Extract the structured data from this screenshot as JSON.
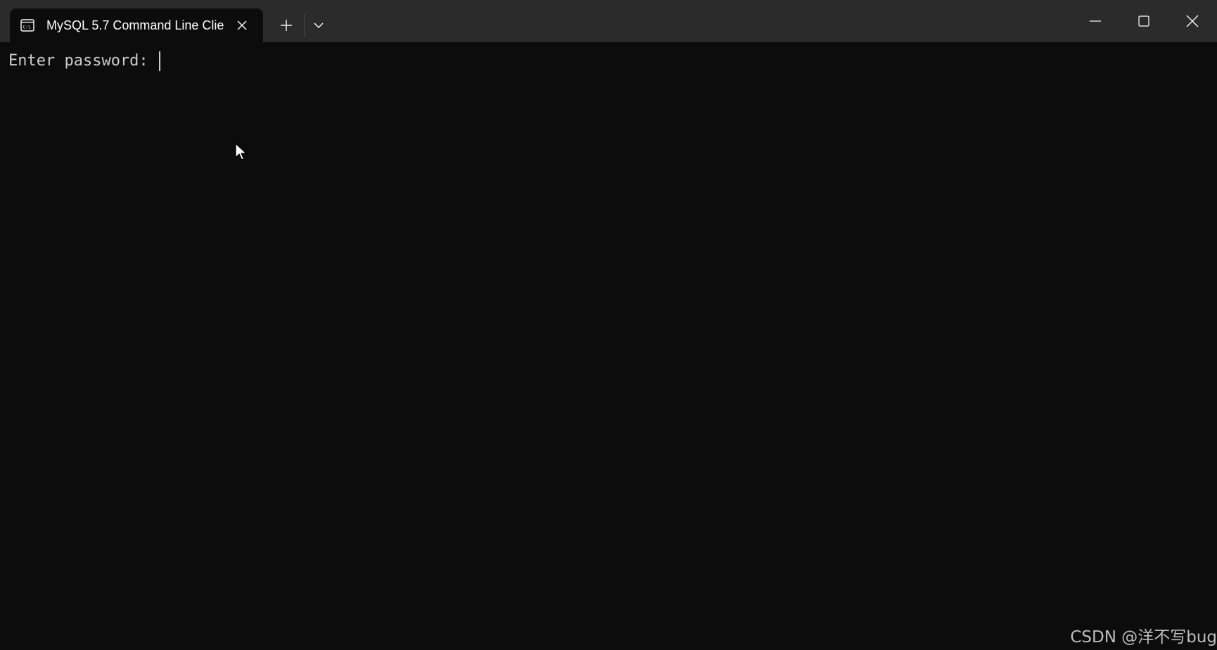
{
  "window": {
    "tab_title": "MySQL 5.7 Command Line Clie",
    "tab_icon": "terminal-icon",
    "new_tab_icon": "plus-icon",
    "dropdown_icon": "chevron-down-icon",
    "controls": {
      "minimize_icon": "minimize-icon",
      "maximize_icon": "maximize-icon",
      "close_icon": "close-icon"
    }
  },
  "terminal": {
    "prompt": "Enter password: "
  },
  "watermark": "CSDN @洋不写bug",
  "colors": {
    "titlebar": "#2b2b2b",
    "background": "#0c0c0c",
    "text": "#cccccc"
  }
}
